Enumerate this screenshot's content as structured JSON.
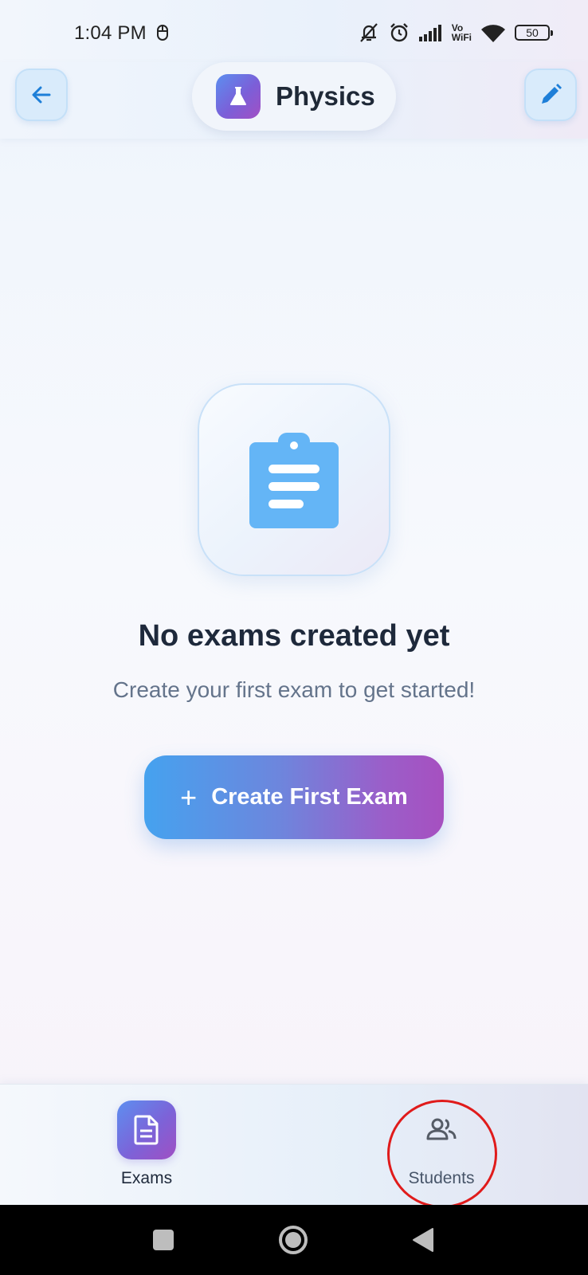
{
  "status_bar": {
    "time": "1:04 PM",
    "vowifi_top": "Vo",
    "vowifi_bottom": "WiFi",
    "battery": "50"
  },
  "header": {
    "title": "Physics"
  },
  "empty_state": {
    "title": "No exams created yet",
    "subtitle": "Create your first exam to get started!",
    "button_label": "Create First Exam"
  },
  "bottom_nav": {
    "items": [
      {
        "label": "Exams",
        "active": true
      },
      {
        "label": "Students",
        "active": false
      }
    ]
  },
  "colors": {
    "accent_blue": "#45a2ef",
    "accent_purple": "#a650c0",
    "highlight_red": "#e01b1b"
  }
}
